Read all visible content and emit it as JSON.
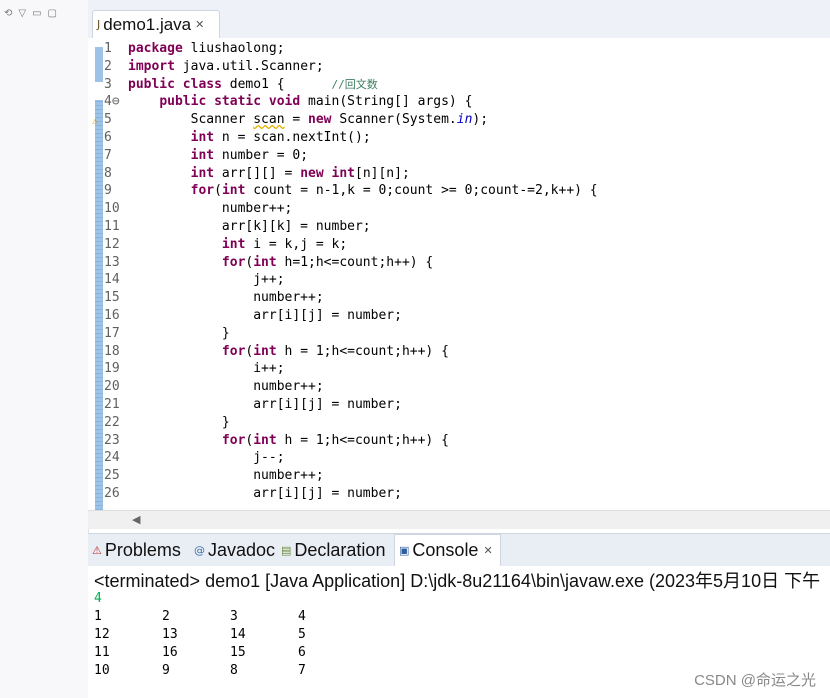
{
  "editor": {
    "tab_label": "demo1.java",
    "lines": [
      {
        "n": "1",
        "html": "<span class=\"kw\">package</span> liushaolong;"
      },
      {
        "n": "2",
        "html": "<span class=\"kw\">import</span> java.util.Scanner;"
      },
      {
        "n": "3",
        "html": "<span class=\"kw\">public</span> <span class=\"kw\">class</span> demo1 {      <span class=\"cm\">//回文数</span>"
      },
      {
        "n": "4⊖",
        "html": "    <span class=\"kw\">public</span> <span class=\"kw\">static</span> <span class=\"kw\">void</span> main(String[] args) {"
      },
      {
        "n": "5",
        "html": "        Scanner <span class=\"warnline\">scan</span> = <span class=\"kw\">new</span> Scanner(System.<span class=\"fld\">in</span>);"
      },
      {
        "n": "6",
        "html": "        <span class=\"kw\">int</span> n = scan.nextInt();"
      },
      {
        "n": "7",
        "html": "        <span class=\"kw\">int</span> number = 0;"
      },
      {
        "n": "8",
        "html": "        <span class=\"kw\">int</span> arr[][] = <span class=\"kw\">new</span> <span class=\"kw\">int</span>[n][n];"
      },
      {
        "n": "9",
        "html": "        <span class=\"kw\">for</span>(<span class=\"kw\">int</span> count = n-1,k = 0;count >= 0;count-=2,k++) {"
      },
      {
        "n": "10",
        "html": "            number++;"
      },
      {
        "n": "11",
        "html": "            arr[k][k] = number;"
      },
      {
        "n": "12",
        "html": "            <span class=\"kw\">int</span> i = k,j = k;"
      },
      {
        "n": "13",
        "html": "            <span class=\"kw\">for</span>(<span class=\"kw\">int</span> h=1;h<=count;h++) {"
      },
      {
        "n": "14",
        "html": "                j++;"
      },
      {
        "n": "15",
        "html": "                number++;"
      },
      {
        "n": "16",
        "html": "                arr[i][j] = number;"
      },
      {
        "n": "17",
        "html": "            }"
      },
      {
        "n": "18",
        "html": "            <span class=\"kw\">for</span>(<span class=\"kw\">int</span> h = 1;h<=count;h++) {"
      },
      {
        "n": "19",
        "html": "                i++;"
      },
      {
        "n": "20",
        "html": "                number++;"
      },
      {
        "n": "21",
        "html": "                arr[i][j] = number;"
      },
      {
        "n": "22",
        "html": "            }"
      },
      {
        "n": "23",
        "html": "            <span class=\"kw\">for</span>(<span class=\"kw\">int</span> h = 1;h<=count;h++) {"
      },
      {
        "n": "24",
        "html": "                j--;"
      },
      {
        "n": "25",
        "html": "                number++;"
      },
      {
        "n": "26",
        "html": "                arr[i][j] = number;"
      }
    ]
  },
  "bottom_tabs": {
    "problems": "Problems",
    "javadoc": "Javadoc",
    "declaration": "Declaration",
    "console": "Console"
  },
  "console": {
    "header": "<terminated> demo1 [Java Application] D:\\jdk-8u21164\\bin\\javaw.exe (2023年5月10日 下午",
    "input": "4",
    "rows": [
      [
        "1",
        "2",
        "3",
        "4"
      ],
      [
        "12",
        "13",
        "14",
        "5"
      ],
      [
        "11",
        "16",
        "15",
        "6"
      ],
      [
        "10",
        "9",
        "8",
        "7"
      ]
    ]
  },
  "watermark": "CSDN @命运之光",
  "icons": [
    "java-file-icon",
    "close-icon",
    "problems-icon",
    "javadoc-icon",
    "declaration-icon",
    "console-icon",
    "warning-icon",
    "collapse-icon"
  ]
}
